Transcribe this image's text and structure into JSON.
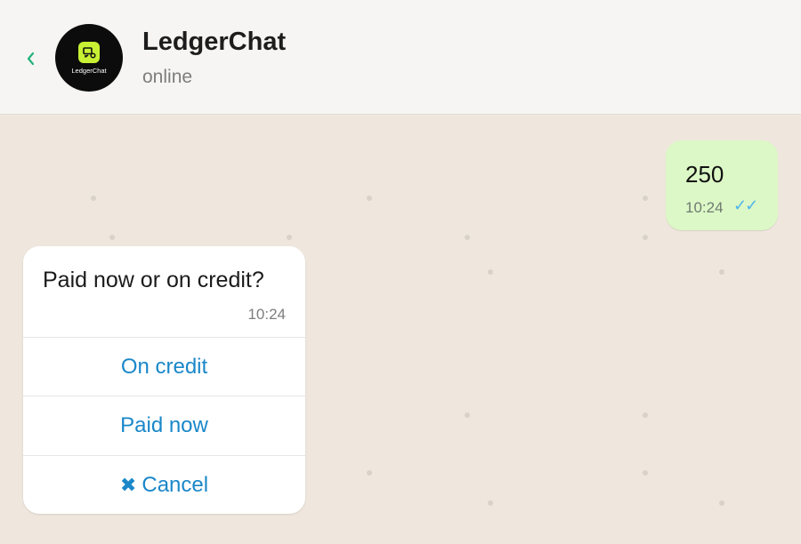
{
  "header": {
    "back_icon": "chevron-left-icon",
    "avatar_text": "LedgerChat",
    "title": "LedgerChat",
    "status": "online",
    "colors": {
      "accent_green": "#24b37a",
      "logo_lime": "#c8f134"
    }
  },
  "messages": [
    {
      "direction": "outgoing",
      "text": "250",
      "time": "10:24",
      "ticks": "✓✓"
    },
    {
      "direction": "incoming",
      "text": "Paid now or on credit?",
      "time": "10:24",
      "options": [
        {
          "label": "On credit"
        },
        {
          "label": "Paid now"
        },
        {
          "label": "Cancel",
          "icon": "✖"
        }
      ]
    }
  ]
}
